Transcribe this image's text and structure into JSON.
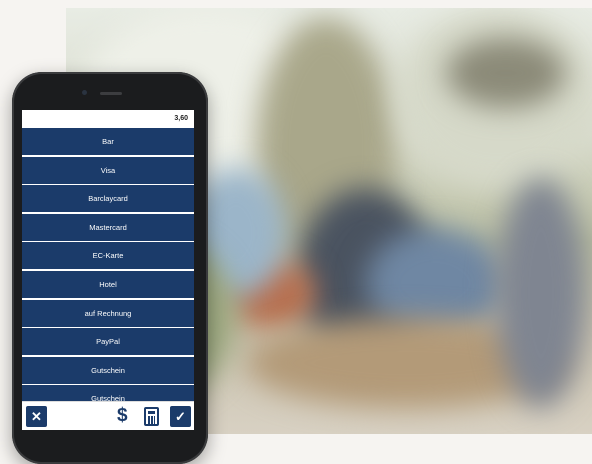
{
  "amount": "3,60",
  "payment_methods": [
    {
      "label": "Bar"
    },
    {
      "label": "Visa"
    },
    {
      "label": "Barclaycard"
    },
    {
      "label": "Mastercard"
    },
    {
      "label": "EC-Karte"
    },
    {
      "label": "Hotel"
    },
    {
      "label": "auf Rechnung"
    },
    {
      "label": "PayPal"
    },
    {
      "label": "Gutschein"
    },
    {
      "label": "Gutschein"
    }
  ],
  "toolbar": {
    "close_icon": "close-icon",
    "dollar_icon": "dollar-icon",
    "calculator_icon": "calculator-icon",
    "confirm_icon": "check-icon"
  },
  "colors": {
    "accent": "#1b3b6a",
    "background": "#f6f4f1"
  }
}
